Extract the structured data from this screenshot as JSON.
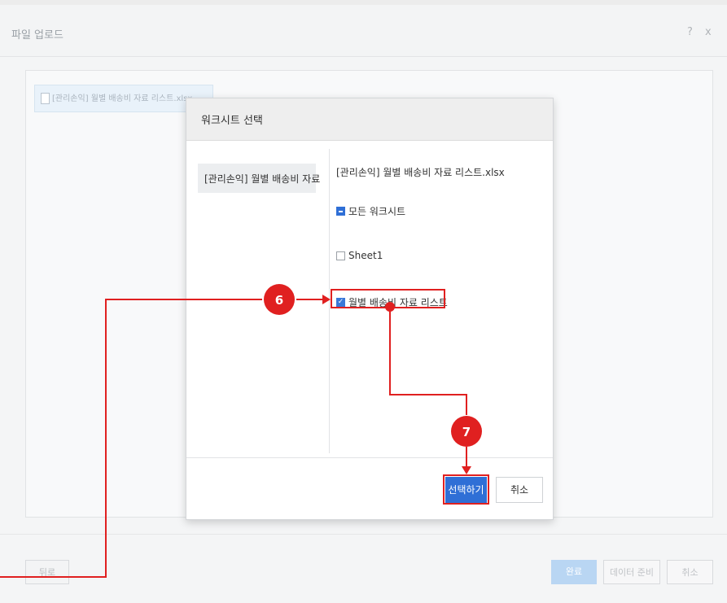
{
  "upload_dialog": {
    "title": "파일 업로드",
    "help_label": "?",
    "close_label": "x",
    "file_tag": "[관리손익] 월별 배송비 자료 리스트.xlsx",
    "back_label": "뒤로",
    "done_label": "완료",
    "prepare_label": "데이터 준비",
    "cancel_label": "취소"
  },
  "worksheet_modal": {
    "title": "워크시트 선택",
    "left_item": "[관리손익] 월별 배송비 자료",
    "file_name": "[관리손익] 월별 배송비 자료 리스트.xlsx",
    "options": [
      {
        "label": "모든 워크시트",
        "state": "partial"
      },
      {
        "label": "Sheet1",
        "state": "unchecked"
      },
      {
        "label": "월별 배송비 자료 리스트",
        "state": "checked"
      }
    ],
    "select_label": "선택하기",
    "cancel_label": "취소"
  },
  "annotations": {
    "step6": "6",
    "step7": "7",
    "color": "#e02020"
  },
  "colors": {
    "primary": "#2f6fd6",
    "annotation": "#e02020"
  }
}
